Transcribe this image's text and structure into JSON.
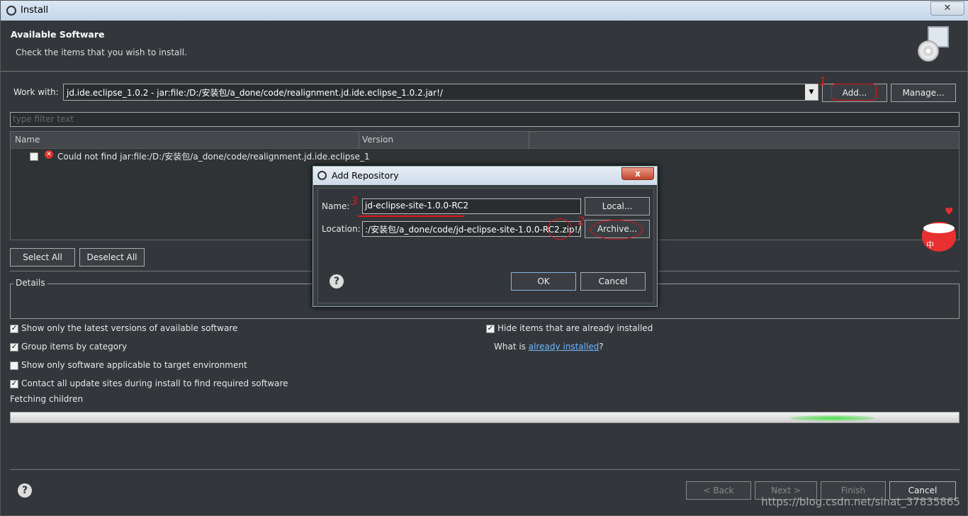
{
  "window": {
    "title": "Install",
    "close_glyph": "✕"
  },
  "header": {
    "title": "Available Software",
    "subtitle": "Check the items that you wish to install."
  },
  "work_with": {
    "label": "Work with:",
    "value": "jd.ide.eclipse_1.0.2 - jar:file:/D:/安装包/a_done/code/realignment.jd.ide.eclipse_1.0.2.jar!/",
    "add_label": "Add...",
    "manage_label": "Manage..."
  },
  "filter": {
    "placeholder": "type filter text"
  },
  "table": {
    "columns": [
      "Name",
      "Version"
    ],
    "rows": [
      {
        "name": "Could not find jar:file:/D:/安装包/a_done/code/realignment.jd.ide.eclipse_1",
        "version": ""
      }
    ]
  },
  "selection": {
    "select_all": "Select All",
    "deselect_all": "Deselect All"
  },
  "details": {
    "legend": "Details"
  },
  "options": {
    "latest": {
      "label": "Show only the latest versions of available software",
      "checked": true
    },
    "group": {
      "label": "Group items by category",
      "checked": true
    },
    "applicable": {
      "label": "Show only software applicable to target environment",
      "checked": false
    },
    "contact": {
      "label": "Contact all update sites during install to find required software",
      "checked": true
    },
    "hide": {
      "label": "Hide items that are already installed",
      "checked": true
    },
    "what_is_prefix": "What is ",
    "what_is_link": "already installed",
    "what_is_suffix": "?"
  },
  "status": {
    "text": "Fetching children"
  },
  "footer": {
    "back": "< Back",
    "next": "Next >",
    "finish": "Finish",
    "cancel": "Cancel"
  },
  "dialog": {
    "title": "Add Repository",
    "close_glyph": "x",
    "name_label": "Name:",
    "name_value": "jd-eclipse-site-1.0.0-RC2",
    "location_label": "Location:",
    "location_value": ":/安装包/a_done/code/jd-eclipse-site-1.0.0-RC2.zip!/",
    "local_label": "Local...",
    "archive_label": "Archive...",
    "ok_label": "OK",
    "cancel_label": "Cancel"
  },
  "annotations": {
    "one": "1",
    "two": "2",
    "three": "3"
  },
  "tray": {
    "ime": "中"
  },
  "watermark": "https://blog.csdn.net/sinat_37835865",
  "colors": {
    "accent_link": "#6cb6ff",
    "annotation_red": "#e0161b",
    "error_red": "#d9342b",
    "progress_green": "#4ee04e"
  }
}
